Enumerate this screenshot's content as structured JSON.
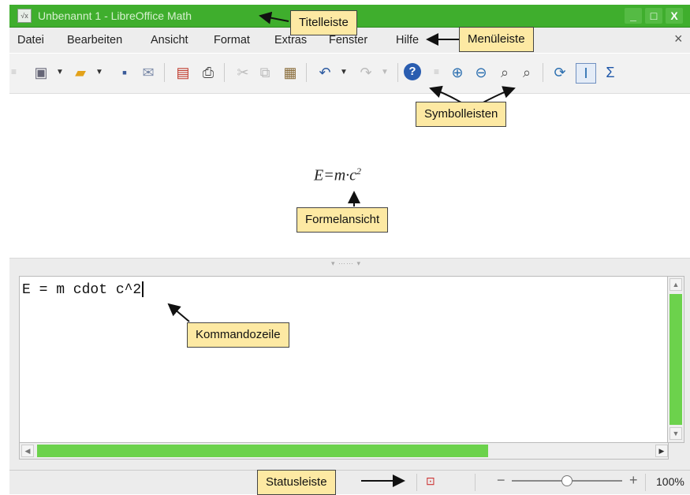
{
  "window": {
    "title": "Unbenannt 1 - LibreOffice Math",
    "controls": [
      "_",
      "□",
      "X"
    ]
  },
  "menu": {
    "items": [
      {
        "label": "Datei"
      },
      {
        "label": "Bearbeiten"
      },
      {
        "label": "Ansicht"
      },
      {
        "label": "Format"
      },
      {
        "label": "Extras"
      },
      {
        "label": "Fenster"
      },
      {
        "label": "Hilfe"
      }
    ],
    "close_glyph": "×"
  },
  "toolbar": {
    "icons": [
      "new-document-icon",
      "open-folder-icon",
      "save-icon",
      "email-icon",
      "export-pdf-icon",
      "print-icon",
      "cut-icon",
      "copy-icon",
      "paste-icon",
      "undo-icon",
      "redo-icon",
      "help-icon",
      "zoom-in-icon",
      "zoom-out-icon",
      "zoom-100-icon",
      "show-all-icon",
      "update-icon",
      "formula-cursor-icon",
      "symbols-icon"
    ]
  },
  "formula": {
    "base": "E=m·c",
    "exponent": "2"
  },
  "command": {
    "text": "E = m cdot c^2"
  },
  "status": {
    "zoom_minus": "−",
    "zoom_plus": "+",
    "zoom_value": "100%"
  },
  "callouts": {
    "titelleiste": "Titelleiste",
    "menueleiste": "Menüleiste",
    "symbolleisten": "Symbolleisten",
    "formelansicht": "Formelansicht",
    "kommandozeile": "Kommandozeile",
    "statusleiste": "Statusleiste"
  },
  "colors": {
    "titlebar": "#3fae2d",
    "scroll_thumb": "#6cd24c",
    "callout_bg": "#fde9a3"
  }
}
